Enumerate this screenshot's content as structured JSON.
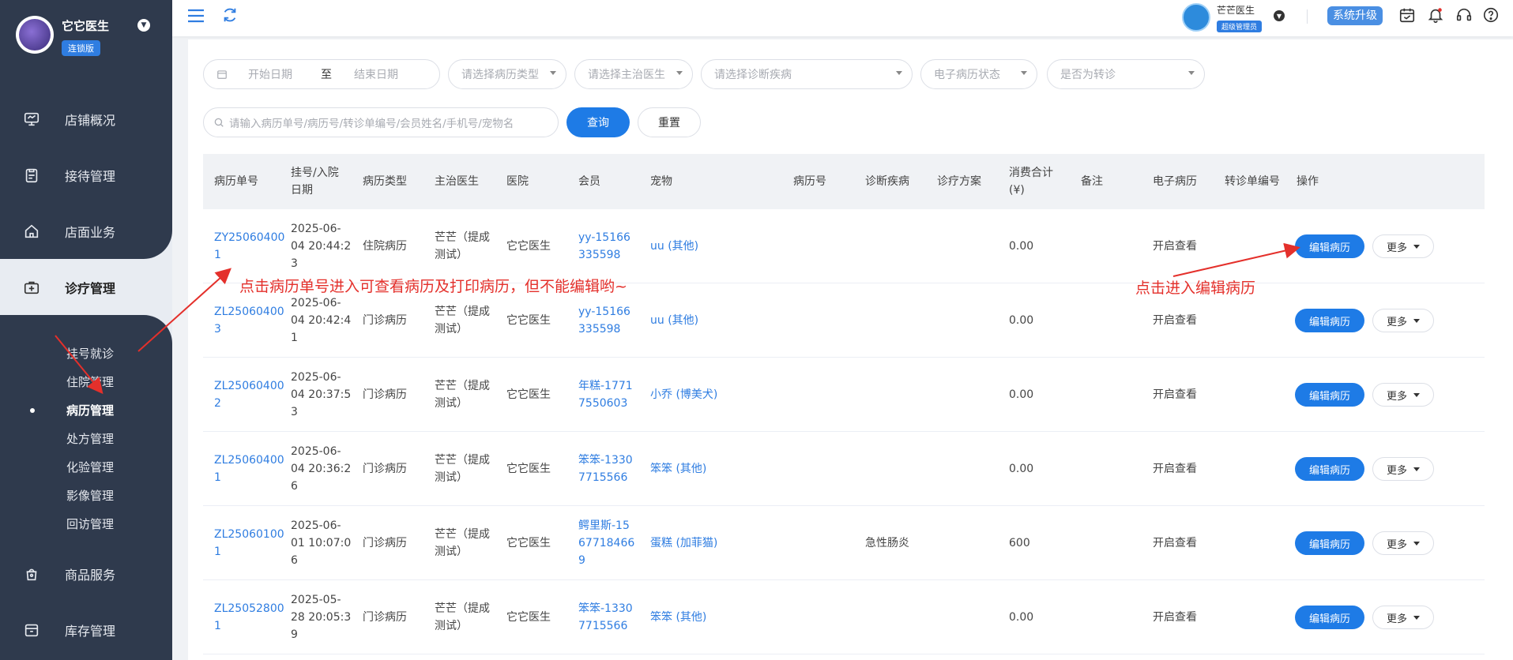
{
  "brand": {
    "name": "它它医生",
    "edition": "连锁版"
  },
  "nav": {
    "items": [
      {
        "label": "店铺概况",
        "icon": "monitor-icon"
      },
      {
        "label": "接待管理",
        "icon": "clipboard-icon"
      },
      {
        "label": "店面业务",
        "icon": "home-icon"
      },
      {
        "label": "诊疗管理",
        "icon": "medical-kit-icon"
      }
    ],
    "sub": [
      {
        "label": "挂号就诊"
      },
      {
        "label": "住院管理"
      },
      {
        "label": "病历管理"
      },
      {
        "label": "处方管理"
      },
      {
        "label": "化验管理"
      },
      {
        "label": "影像管理"
      },
      {
        "label": "回访管理"
      }
    ],
    "bottom": [
      {
        "label": "商品服务",
        "icon": "bag-icon"
      },
      {
        "label": "库存管理",
        "icon": "box-icon"
      }
    ]
  },
  "topbar": {
    "user_name": "芒芒医生",
    "user_role": "超级管理员",
    "upgrade": "系统升级"
  },
  "filters": {
    "start_date": "开始日期",
    "to": "至",
    "end_date": "结束日期",
    "record_type": "请选择病历类型",
    "doctor": "请选择主治医生",
    "disease": "请选择诊断疾病",
    "emr_status": "电子病历状态",
    "referral": "是否为转诊",
    "search_placeholder": "请输入病历单号/病历号/转诊单编号/会员姓名/手机号/宠物名",
    "query": "查询",
    "reset": "重置"
  },
  "table": {
    "headers": [
      "病历单号",
      "挂号/入院日期",
      "病历类型",
      "主治医生",
      "医院",
      "会员",
      "宠物",
      "病历号",
      "诊断疾病",
      "诊疗方案",
      "消费合计(¥)",
      "备注",
      "电子病历",
      "转诊单编号",
      "操作"
    ],
    "header_lines": {
      "date": [
        "挂号/入院",
        "日期"
      ],
      "amount": [
        "消费合计",
        "(¥)"
      ]
    },
    "edit_label": "编辑病历",
    "more_label": "更多",
    "rows": [
      {
        "id": [
          "ZY25060400",
          "1"
        ],
        "date": [
          "2025-06-",
          "04 20:44:2",
          "3"
        ],
        "type": "住院病历",
        "doctor": [
          "芒芒（提成",
          "测试）"
        ],
        "hospital": "它它医生",
        "member": [
          "yy-15166",
          "335598"
        ],
        "pet": "uu (其他)",
        "disease": "",
        "amount": "0.00",
        "emr": "开启查看"
      },
      {
        "id": [
          "ZL25060400",
          "3"
        ],
        "date": [
          "2025-06-",
          "04 20:42:4",
          "1"
        ],
        "type": "门诊病历",
        "doctor": [
          "芒芒（提成",
          "测试）"
        ],
        "hospital": "它它医生",
        "member": [
          "yy-15166",
          "335598"
        ],
        "pet": "uu (其他)",
        "disease": "",
        "amount": "0.00",
        "emr": "开启查看"
      },
      {
        "id": [
          "ZL25060400",
          "2"
        ],
        "date": [
          "2025-06-",
          "04 20:37:5",
          "3"
        ],
        "type": "门诊病历",
        "doctor": [
          "芒芒（提成",
          "测试）"
        ],
        "hospital": "它它医生",
        "member": [
          "年糕-1771",
          "7550603"
        ],
        "pet": "小乔 (博美犬)",
        "disease": "",
        "amount": "0.00",
        "emr": "开启查看"
      },
      {
        "id": [
          "ZL25060400",
          "1"
        ],
        "date": [
          "2025-06-",
          "04 20:36:2",
          "6"
        ],
        "type": "门诊病历",
        "doctor": [
          "芒芒（提成",
          "测试）"
        ],
        "hospital": "它它医生",
        "member": [
          "笨笨-1330",
          "7715566"
        ],
        "pet": "笨笨 (其他)",
        "disease": "",
        "amount": "0.00",
        "emr": "开启查看"
      },
      {
        "id": [
          "ZL25060100",
          "1"
        ],
        "date": [
          "2025-06-",
          "01 10:07:0",
          "6"
        ],
        "type": "门诊病历",
        "doctor": [
          "芒芒（提成",
          "测试）"
        ],
        "hospital": "它它医生",
        "member": [
          "鳄里斯-15",
          "67718466",
          "9"
        ],
        "pet": "蛋糕 (加菲猫)",
        "disease": "急性肠炎",
        "amount": "600",
        "emr": "开启查看"
      },
      {
        "id": [
          "ZL25052800",
          "1"
        ],
        "date": [
          "2025-05-",
          "28 20:05:3",
          "9"
        ],
        "type": "门诊病历",
        "doctor": [
          "芒芒（提成",
          "测试）"
        ],
        "hospital": "它它医生",
        "member": [
          "笨笨-1330",
          "7715566"
        ],
        "pet": "笨笨 (其他)",
        "disease": "",
        "amount": "0.00",
        "emr": "开启查看"
      }
    ]
  },
  "annotations": {
    "left": "点击病历单号进入可查看病历及打印病历，但不能编辑哟~",
    "right": "点击进入编辑病历"
  },
  "colors": {
    "primary": "#1e7be6",
    "sidebar": "#2f3a4d",
    "annotation": "#e4302b"
  }
}
